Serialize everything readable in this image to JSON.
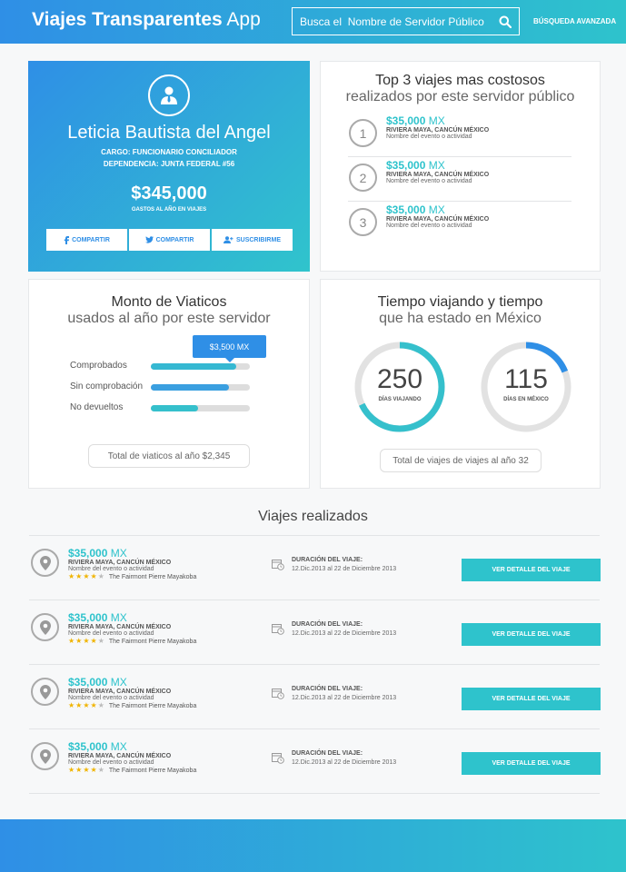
{
  "header": {
    "app_name_bold": "Viajes Transparentes",
    "app_name_light": "App",
    "search_placeholder": "Busca el  Nombre de Servidor Público",
    "advanced_search": "BÚSQUEDA AVANZADA"
  },
  "profile": {
    "name": "Leticia Bautista del Angel",
    "cargo": "CARGO: FUNCIONARIO CONCILIADOR",
    "dependencia": "DEPENDENCIA: JUNTA FEDERAL #56",
    "amount": "$345,000",
    "amount_label": "GASTOS AL AÑO EN VIAJES",
    "buttons": [
      {
        "label": "COMPARTIR",
        "icon": "facebook-icon"
      },
      {
        "label": "COMPARTIR",
        "icon": "twitter-icon"
      },
      {
        "label": "SUSCRIBIRME",
        "icon": "add-user-icon"
      }
    ]
  },
  "top3": {
    "title": "Top 3 viajes mas costosos",
    "subtitle": "realizados por este servidor público",
    "items": [
      {
        "rank": "1",
        "amount": "$35,000",
        "currency": "MX",
        "location": "RIVIERA MAYA, CANCÚN MÉXICO",
        "event": "Nombre del evento o actividad"
      },
      {
        "rank": "2",
        "amount": "$35,000",
        "currency": "MX",
        "location": "RIVIERA MAYA, CANCÚN MÉXICO",
        "event": "Nombre del evento o actividad"
      },
      {
        "rank": "3",
        "amount": "$35,000",
        "currency": "MX",
        "location": "RIVIERA MAYA, CANCÚN MÉXICO",
        "event": "Nombre del evento o actividad"
      }
    ]
  },
  "viaticos": {
    "title": "Monto de Viaticos",
    "subtitle": "usados al año por este servidor",
    "tooltip": "$3,500 MX",
    "bars": [
      {
        "label": "Comprobados",
        "fraction": 0.86,
        "color": "#35b8d2"
      },
      {
        "label": "Sin comprobación",
        "fraction": 0.79,
        "color": "#3a9fe0"
      },
      {
        "label": "No devueltos",
        "fraction": 0.48,
        "color": "#35c0cc"
      }
    ],
    "total": "Total de viaticos al año $2,345"
  },
  "tiempo": {
    "title": "Tiempo viajando y tiempo",
    "subtitle": "que ha estado en México",
    "rings": [
      {
        "value": "250",
        "label": "DÍAS VIAJANDO",
        "fraction": 0.68,
        "color": "#35c0cc"
      },
      {
        "value": "115",
        "label": "DÍAS EN MÉXICO",
        "fraction": 0.19,
        "color": "#2f8fe6"
      }
    ],
    "total": "Total de viajes de viajes al año 32"
  },
  "trips": {
    "title": "Viajes realizados",
    "duration_label": "DURACIÓN DEL VIAJE:",
    "button_label": "VER DETALLE DEL VIAJE",
    "items": [
      {
        "amount": "$35,000",
        "currency": "MX",
        "location": "RIVIERA MAYA, CANCÚN MÉXICO",
        "event": "Nombre del evento o actividad",
        "rating": 4,
        "hotel": "The Fairmont Pierre Mayakoba",
        "dates": "12.Dic.2013  al  22 de Diciembre 2013"
      },
      {
        "amount": "$35,000",
        "currency": "MX",
        "location": "RIVIERA MAYA, CANCÚN MÉXICO",
        "event": "Nombre del evento o actividad",
        "rating": 4,
        "hotel": "The Fairmont Pierre Mayakoba",
        "dates": "12.Dic.2013  al  22 de Diciembre 2013"
      },
      {
        "amount": "$35,000",
        "currency": "MX",
        "location": "RIVIERA MAYA, CANCÚN MÉXICO",
        "event": "Nombre del evento o actividad",
        "rating": 4,
        "hotel": "The Fairmont Pierre Mayakoba",
        "dates": "12.Dic.2013  al  22 de Diciembre 2013"
      },
      {
        "amount": "$35,000",
        "currency": "MX",
        "location": "RIVIERA MAYA, CANCÚN MÉXICO",
        "event": "Nombre del evento o actividad",
        "rating": 4,
        "hotel": "The Fairmont Pierre Mayakoba",
        "dates": "12.Dic.2013  al  22 de Diciembre 2013"
      }
    ]
  }
}
